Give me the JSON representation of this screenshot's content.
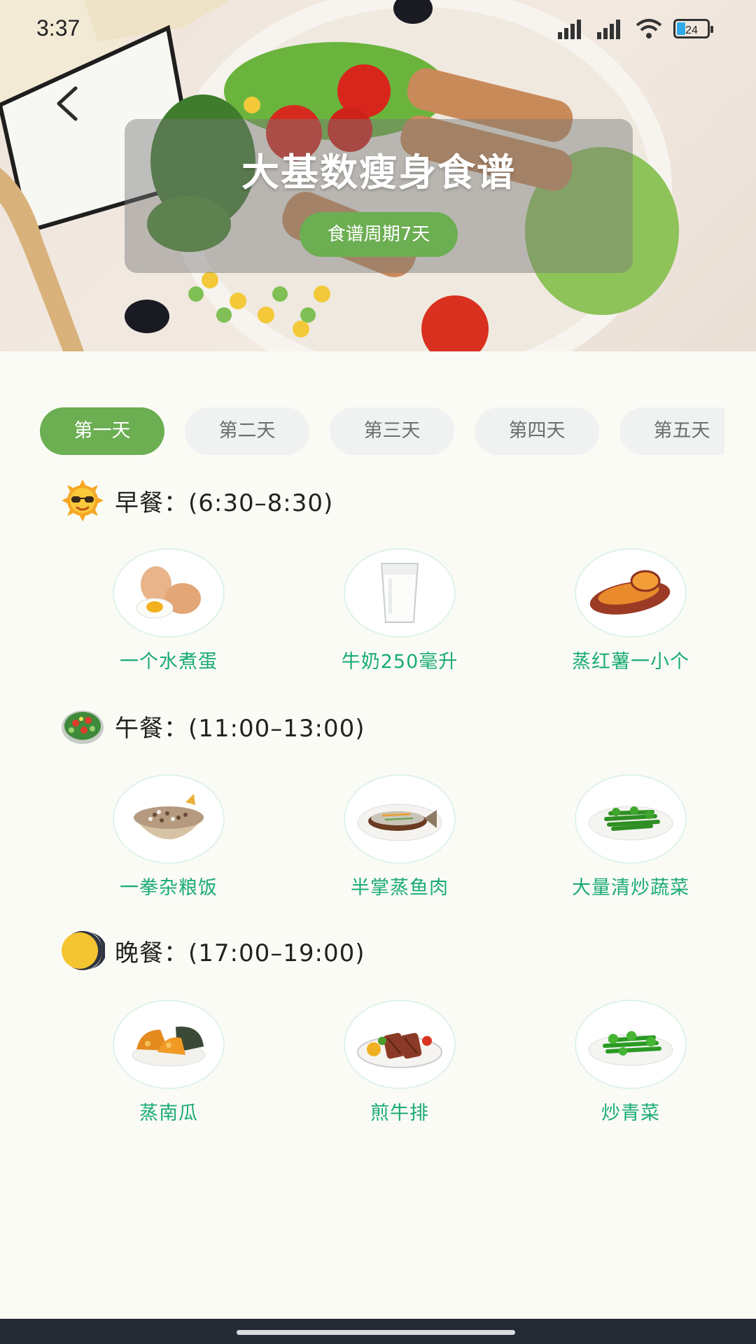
{
  "status_bar": {
    "time": "3:37",
    "battery": "24"
  },
  "header": {
    "title": "大基数瘦身食谱",
    "period": "食谱周期7天"
  },
  "tabs": [
    "第一天",
    "第二天",
    "第三天",
    "第四天",
    "第五天"
  ],
  "active_tab": "第一天",
  "meals": [
    {
      "title": "早餐：(6:30–8:30)",
      "icon": "sun-sunglasses-icon",
      "foods": [
        {
          "label": "一个水煮蛋",
          "icon": "boiled-egg-icon"
        },
        {
          "label": "牛奶250毫升",
          "icon": "milk-glass-icon"
        },
        {
          "label": "蒸红薯一小个",
          "icon": "sweet-potato-icon"
        }
      ]
    },
    {
      "title": "午餐：(11:00–13:00)",
      "icon": "salad-bowl-icon",
      "foods": [
        {
          "label": "一拳杂粮饭",
          "icon": "grain-rice-icon"
        },
        {
          "label": "半掌蒸鱼肉",
          "icon": "steamed-fish-icon"
        },
        {
          "label": "大量清炒蔬菜",
          "icon": "stir-fried-greens-icon"
        }
      ]
    },
    {
      "title": "晚餐：(17:00–19:00)",
      "icon": "moon-icon",
      "foods": [
        {
          "label": "蒸南瓜",
          "icon": "steamed-pumpkin-icon"
        },
        {
          "label": "煎牛排",
          "icon": "steak-icon"
        },
        {
          "label": "炒青菜",
          "icon": "green-vegetables-icon"
        }
      ]
    }
  ],
  "colors": {
    "accent": "#6cae52",
    "food_label": "#19ab73",
    "page_bg": "#fbfbf6"
  }
}
